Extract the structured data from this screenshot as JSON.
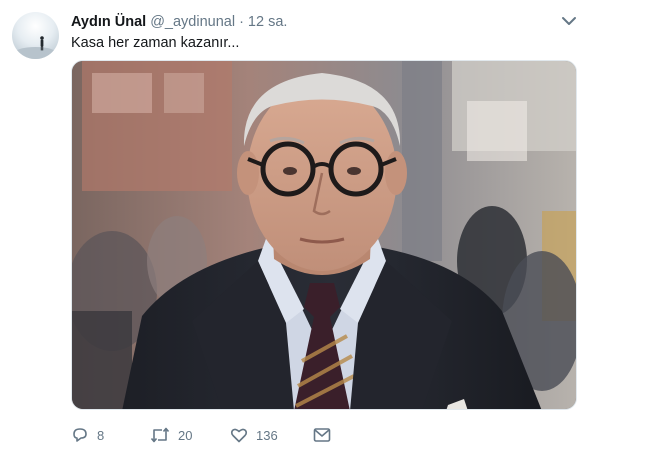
{
  "tweet": {
    "author": {
      "display_name": "Aydın Ünal",
      "handle": "@_aydinunal"
    },
    "separator": "·",
    "timestamp": "12 sa.",
    "text": "Kasa her zaman kazanır...",
    "actions": {
      "replies": "8",
      "retweets": "20",
      "likes": "136"
    },
    "icons": [
      "avatar",
      "chevron-down-icon",
      "reply-icon",
      "retweet-icon",
      "heart-icon",
      "envelope-icon"
    ]
  },
  "colors": {
    "text_primary": "#14171a",
    "text_secondary": "#657786",
    "border": "#e1e8ed"
  }
}
